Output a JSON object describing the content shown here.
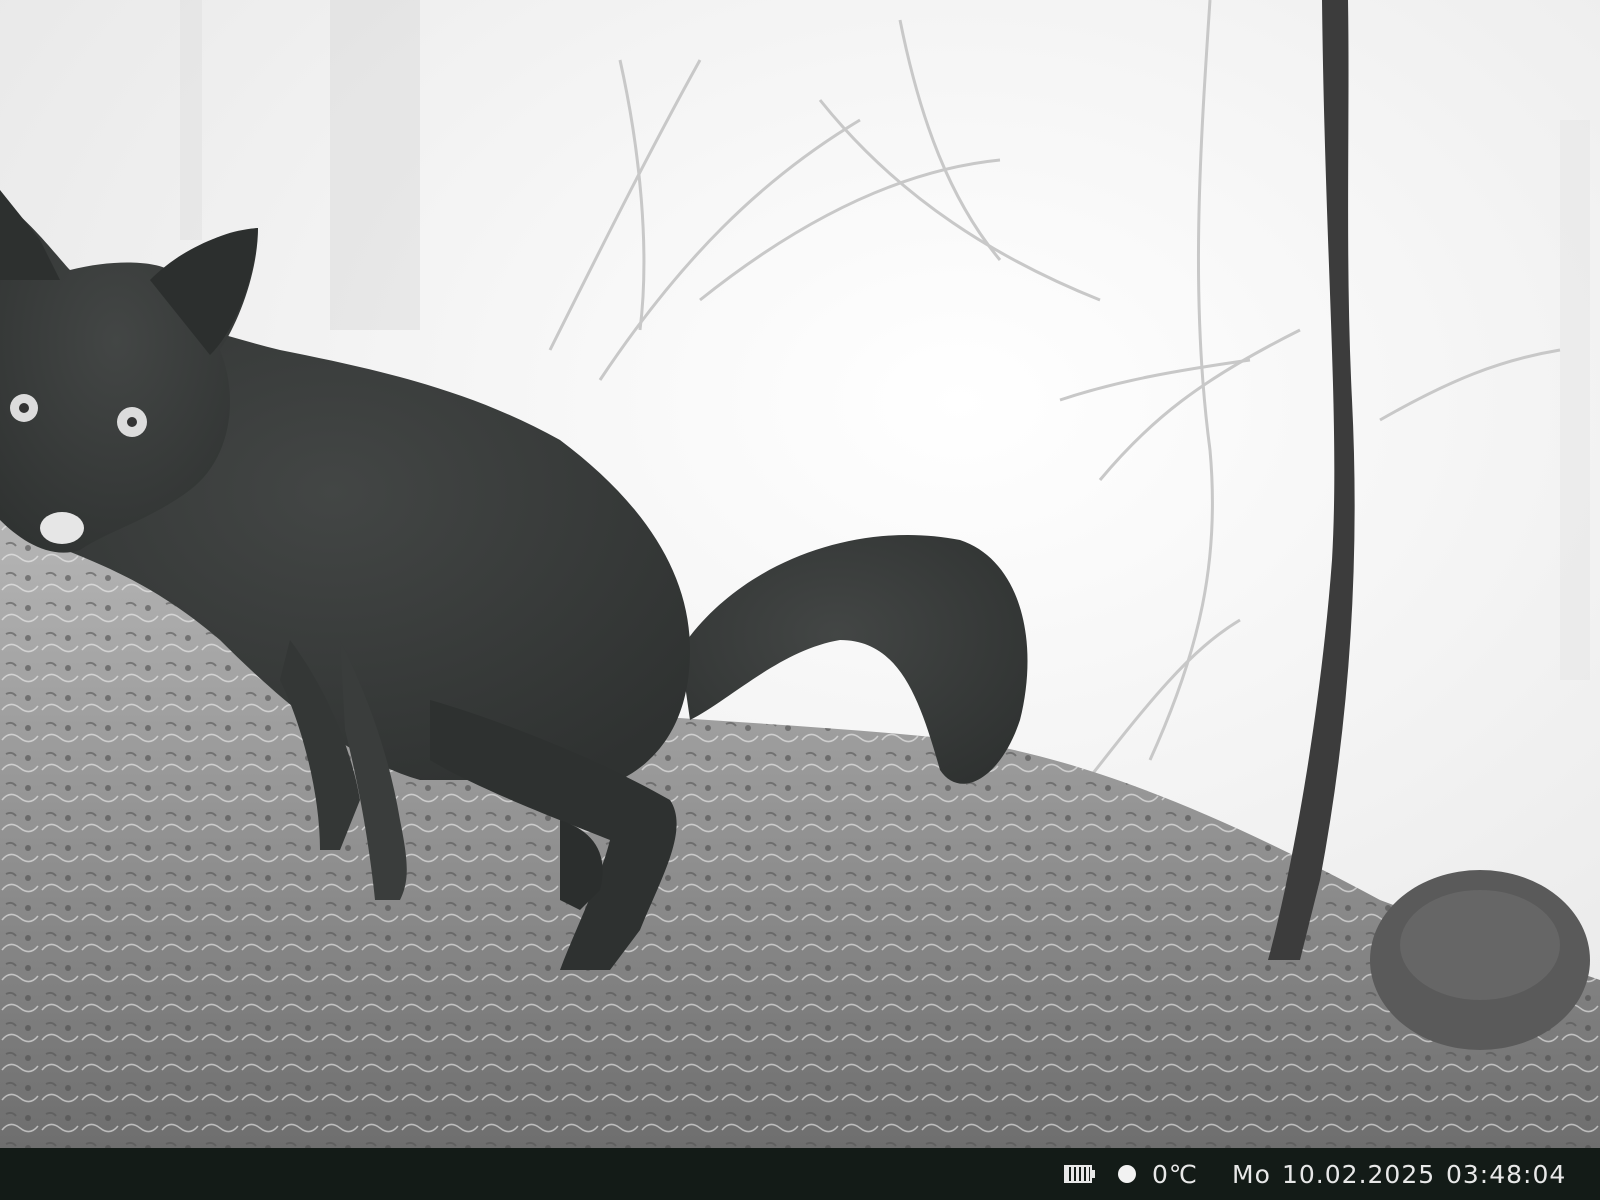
{
  "scene": {
    "description_label": "Infrared trail camera photo of a fox in a foggy forest",
    "colors": {
      "fog": "#f4f4f4",
      "ground": "#8a8a8a",
      "fox": "#3a3d3c",
      "bar": "#131b17",
      "text": "#e8e8e8"
    }
  },
  "info_bar": {
    "battery_icon": "battery-icon",
    "moon_icon": "moon-icon",
    "temperature": "0℃",
    "day": "Mo",
    "date": "10.02.2025",
    "time": "03:48:04"
  }
}
